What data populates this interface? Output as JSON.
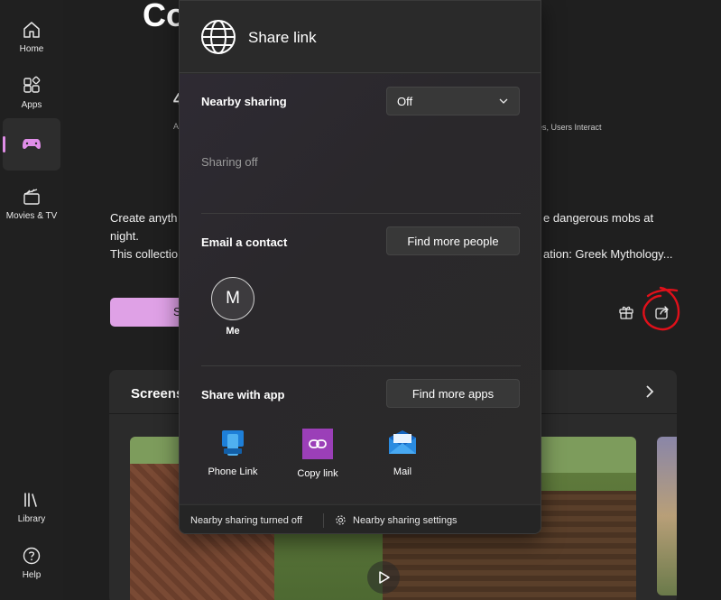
{
  "sidebar": {
    "items": [
      {
        "label": "Home",
        "icon": "home-icon"
      },
      {
        "label": "Apps",
        "icon": "apps-icon"
      },
      {
        "label": "",
        "icon": "gaming-icon",
        "active": true
      },
      {
        "label": "Movies & TV",
        "icon": "movies-icon"
      },
      {
        "label": "Library",
        "icon": "library-icon"
      },
      {
        "label": "Help",
        "icon": "help-icon"
      }
    ]
  },
  "main": {
    "title_fragment": "Co",
    "stat_fragment": "4",
    "stat_sub_fragment": "A",
    "tags_fragment": "es, Users Interact",
    "desc_line1_left": "Create anyth",
    "desc_line1_right": "e dangerous mobs at",
    "desc_line2": "night.",
    "desc_line3_left": "This collectio",
    "desc_line3_right": "ation: Greek Mythology...",
    "buy_fragment": "S",
    "screenshots_title": "Screens"
  },
  "flyout": {
    "title": "Share link",
    "nearby_label": "Nearby sharing",
    "nearby_value": "Off",
    "sharing_status": "Sharing off",
    "email_label": "Email a contact",
    "find_people": "Find more people",
    "contact_initial": "M",
    "contact_name": "Me",
    "share_app_label": "Share with app",
    "find_apps": "Find more apps",
    "apps": [
      {
        "name": "Phone Link",
        "icon": "phone-link-icon"
      },
      {
        "name": "Copy link",
        "icon": "copy-link-icon"
      },
      {
        "name": "Mail",
        "icon": "mail-icon"
      }
    ],
    "footer_status": "Nearby sharing turned off",
    "footer_settings": "Nearby sharing settings"
  },
  "colors": {
    "accent": "#dfa1e6",
    "annotation": "#e0101a"
  }
}
